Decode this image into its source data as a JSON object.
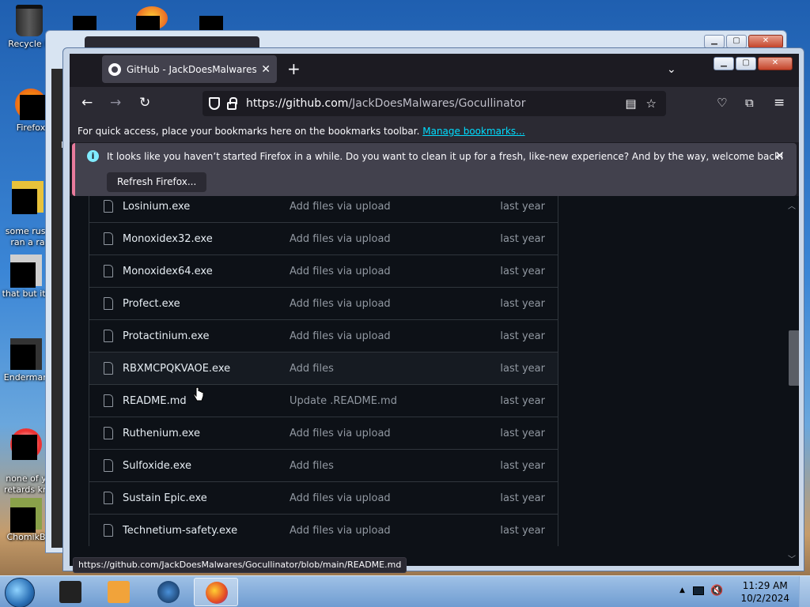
{
  "desktop": {
    "icons": [
      {
        "label": "Recycle B"
      },
      {
        "label": "Firefox"
      },
      {
        "label": "some russ\nran a ra"
      },
      {
        "label": "that but its"
      },
      {
        "label": "Enderman"
      },
      {
        "label": "none of y\nretards kn"
      },
      {
        "label": "ChomikB"
      }
    ]
  },
  "browser": {
    "tab_title": "GitHub - JackDoesMalwares/Gocullinator",
    "url_host": "https://github.com",
    "url_path": "/JackDoesMalwares/Gocullinator",
    "bookmarks_prompt": "For quick access, place your bookmarks here on the bookmarks toolbar.",
    "manage_bookmarks": "Manage bookmarks...",
    "notice_message": "It looks like you haven’t started Firefox in a while. Do you want to clean it up for a fresh, like-new experience? And by the way, welcome back!",
    "refresh_button": "Refresh Firefox...",
    "status_url": "https://github.com/JackDoesMalwares/Gocullinator/blob/main/README.md"
  },
  "files": [
    {
      "name": "Losinium.exe",
      "message": "Add files via upload",
      "date": "last year"
    },
    {
      "name": "Monoxidex32.exe",
      "message": "Add files via upload",
      "date": "last year"
    },
    {
      "name": "Monoxidex64.exe",
      "message": "Add files via upload",
      "date": "last year"
    },
    {
      "name": "Profect.exe",
      "message": "Add files via upload",
      "date": "last year"
    },
    {
      "name": "Protactinium.exe",
      "message": "Add files via upload",
      "date": "last year"
    },
    {
      "name": "RBXMCPQKVAOE.exe",
      "message": "Add files",
      "date": "last year"
    },
    {
      "name": "README.md",
      "message": "Update .README.md",
      "date": "last year"
    },
    {
      "name": "Ruthenium.exe",
      "message": "Add files via upload",
      "date": "last year"
    },
    {
      "name": "Sulfoxide.exe",
      "message": "Add files",
      "date": "last year"
    },
    {
      "name": "Sustain Epic.exe",
      "message": "Add files via upload",
      "date": "last year"
    },
    {
      "name": "Technetium-safety.exe",
      "message": "Add files via upload",
      "date": "last year"
    }
  ],
  "taskbar": {
    "time": "11:29 AM",
    "date": "10/2/2024"
  },
  "colors": {
    "page_bg": "#0d1117",
    "link": "#00ddff",
    "notice_accent": "#e87b9c"
  }
}
